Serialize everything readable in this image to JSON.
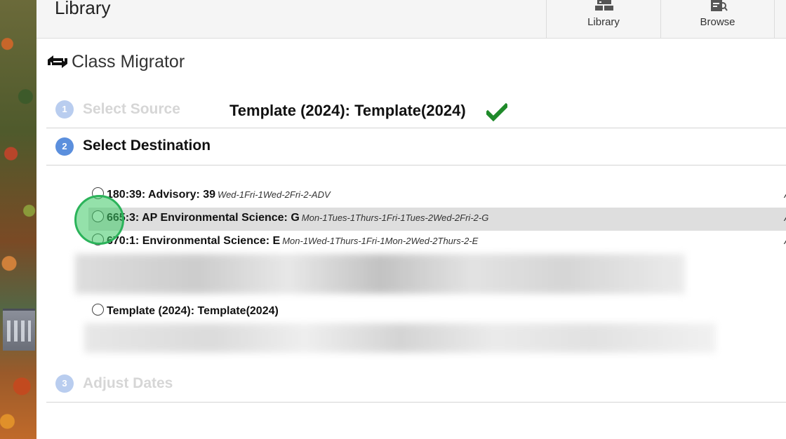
{
  "header": {
    "title": "Library",
    "tabs": [
      {
        "label": "Library",
        "icon": "library-icon"
      },
      {
        "label": "Browse",
        "icon": "browse-icon"
      }
    ]
  },
  "page": {
    "title": "Class Migrator",
    "title_icon": "migrate-icon"
  },
  "steps": [
    {
      "number": "1",
      "label": "Select Source",
      "state": "completed",
      "value": "Template (2024): Template(2024)"
    },
    {
      "number": "2",
      "label": "Select Destination",
      "state": "active"
    },
    {
      "number": "3",
      "label": "Adjust Dates",
      "state": "pending"
    }
  ],
  "destinations": [
    {
      "name": "180:39: Advisory: 39",
      "schedule": "Wed-1Fri-1Wed-2Fri-2-ADV",
      "extra": "A",
      "selected": false
    },
    {
      "name": "665:3: AP Environmental Science: G",
      "schedule": "Mon-1Tues-1Thurs-1Fri-1Tues-2Wed-2Fri-2-G",
      "extra": "A",
      "selected": false
    },
    {
      "name": "670:1: Environmental Science: E",
      "schedule": "Mon-1Wed-1Thurs-1Fri-1Mon-2Wed-2Thurs-2-E",
      "extra": "A",
      "selected": false
    },
    {
      "name": "Template (2024): Template(2024)",
      "schedule": "",
      "extra": "",
      "selected": false
    }
  ],
  "colors": {
    "step_active": "#5b8fdd",
    "step_inactive": "#b9cdef",
    "check": "#1f8a2a",
    "highlight_row": "#dedede",
    "click_indicator": "#2bb35a"
  }
}
